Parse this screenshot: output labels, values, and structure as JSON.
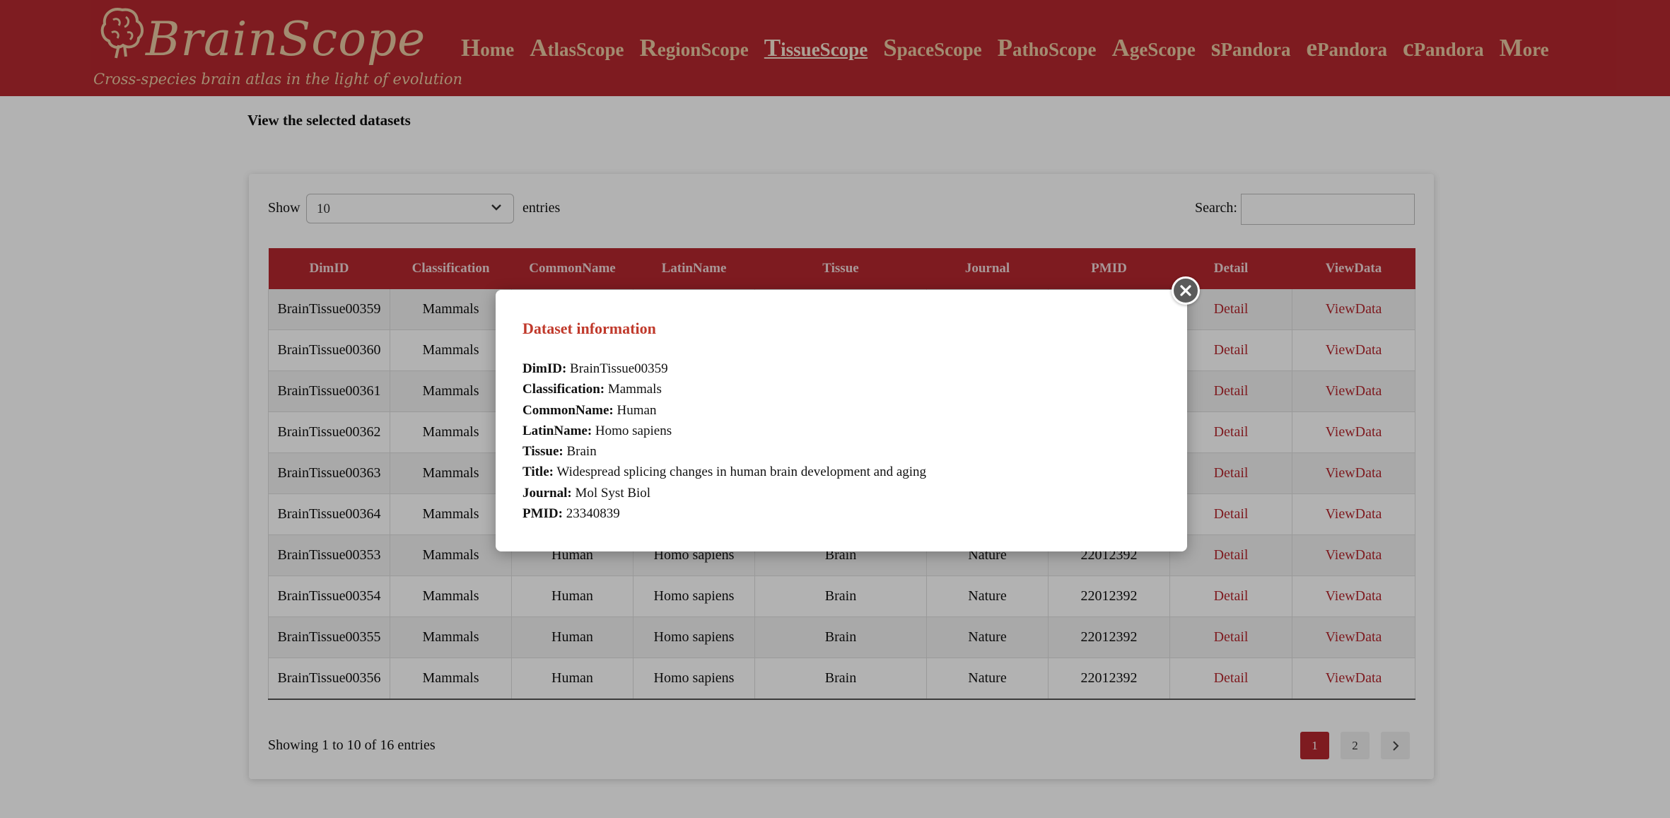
{
  "brand": {
    "title": "BrainScope",
    "subtitle": "Cross-species brain atlas in the light of evolution",
    "color_primary": "#b5282f",
    "color_logo": "#e8c9a3"
  },
  "nav": {
    "items": [
      {
        "label": "Home"
      },
      {
        "label": "AtlasScope"
      },
      {
        "label": "RegionScope"
      },
      {
        "label": "TissueScope"
      },
      {
        "label": "SpaceScope"
      },
      {
        "label": "PathoScope"
      },
      {
        "label": "AgeScope"
      },
      {
        "label": "sPandora"
      },
      {
        "label": "ePandora"
      },
      {
        "label": "cPandora"
      },
      {
        "label": "More"
      }
    ],
    "active": "TissueScope"
  },
  "page": {
    "heading": "View the selected datasets"
  },
  "controls": {
    "show_label": "Show",
    "entries_select_value": "10",
    "entries_label": "entries",
    "search_label": "Search:",
    "search_value": ""
  },
  "table": {
    "columns": [
      "DimID",
      "Classification",
      "CommonName",
      "LatinName",
      "Tissue",
      "Journal",
      "PMID",
      "Detail",
      "ViewData"
    ],
    "rows": [
      {
        "DimID": "BrainTissue00359",
        "Classification": "Mammals",
        "CommonName": "",
        "LatinName": "",
        "Tissue": "",
        "Journal": "",
        "PMID": "",
        "Detail": "Detail",
        "ViewData": "ViewData"
      },
      {
        "DimID": "BrainTissue00360",
        "Classification": "Mammals",
        "CommonName": "",
        "LatinName": "",
        "Tissue": "",
        "Journal": "",
        "PMID": "",
        "Detail": "Detail",
        "ViewData": "ViewData"
      },
      {
        "DimID": "BrainTissue00361",
        "Classification": "Mammals",
        "CommonName": "",
        "LatinName": "",
        "Tissue": "",
        "Journal": "",
        "PMID": "",
        "Detail": "Detail",
        "ViewData": "ViewData"
      },
      {
        "DimID": "BrainTissue00362",
        "Classification": "Mammals",
        "CommonName": "",
        "LatinName": "",
        "Tissue": "",
        "Journal": "",
        "PMID": "",
        "Detail": "Detail",
        "ViewData": "ViewData"
      },
      {
        "DimID": "BrainTissue00363",
        "Classification": "Mammals",
        "CommonName": "",
        "LatinName": "",
        "Tissue": "",
        "Journal": "",
        "PMID": "",
        "Detail": "Detail",
        "ViewData": "ViewData"
      },
      {
        "DimID": "BrainTissue00364",
        "Classification": "Mammals",
        "CommonName": "",
        "LatinName": "",
        "Tissue": "",
        "Journal": "",
        "PMID": "",
        "Detail": "Detail",
        "ViewData": "ViewData"
      },
      {
        "DimID": "BrainTissue00353",
        "Classification": "Mammals",
        "CommonName": "Human",
        "LatinName": "Homo sapiens",
        "Tissue": "Brain",
        "Journal": "Nature",
        "PMID": "22012392",
        "Detail": "Detail",
        "ViewData": "ViewData"
      },
      {
        "DimID": "BrainTissue00354",
        "Classification": "Mammals",
        "CommonName": "Human",
        "LatinName": "Homo sapiens",
        "Tissue": "Brain",
        "Journal": "Nature",
        "PMID": "22012392",
        "Detail": "Detail",
        "ViewData": "ViewData"
      },
      {
        "DimID": "BrainTissue00355",
        "Classification": "Mammals",
        "CommonName": "Human",
        "LatinName": "Homo sapiens",
        "Tissue": "Brain",
        "Journal": "Nature",
        "PMID": "22012392",
        "Detail": "Detail",
        "ViewData": "ViewData"
      },
      {
        "DimID": "BrainTissue00356",
        "Classification": "Mammals",
        "CommonName": "Human",
        "LatinName": "Homo sapiens",
        "Tissue": "Brain",
        "Journal": "Nature",
        "PMID": "22012392",
        "Detail": "Detail",
        "ViewData": "ViewData"
      }
    ]
  },
  "footer": {
    "showing": "Showing 1 to 10 of 16 entries",
    "pages": [
      "1",
      "2"
    ],
    "current_page": "1",
    "next_icon": "chevron-right-icon"
  },
  "modal": {
    "title": "Dataset information",
    "fields": [
      {
        "label": "DimID:",
        "value": "BrainTissue00359"
      },
      {
        "label": "Classification:",
        "value": "Mammals"
      },
      {
        "label": "CommonName:",
        "value": "Human"
      },
      {
        "label": "LatinName:",
        "value": "Homo sapiens"
      },
      {
        "label": "Tissue:",
        "value": "Brain"
      },
      {
        "label": "Title:",
        "value": "Widespread splicing changes in human brain development and aging"
      },
      {
        "label": "Journal:",
        "value": "Mol Syst Biol"
      },
      {
        "label": "PMID:",
        "value": "23340839"
      }
    ],
    "close_icon": "close-icon"
  }
}
